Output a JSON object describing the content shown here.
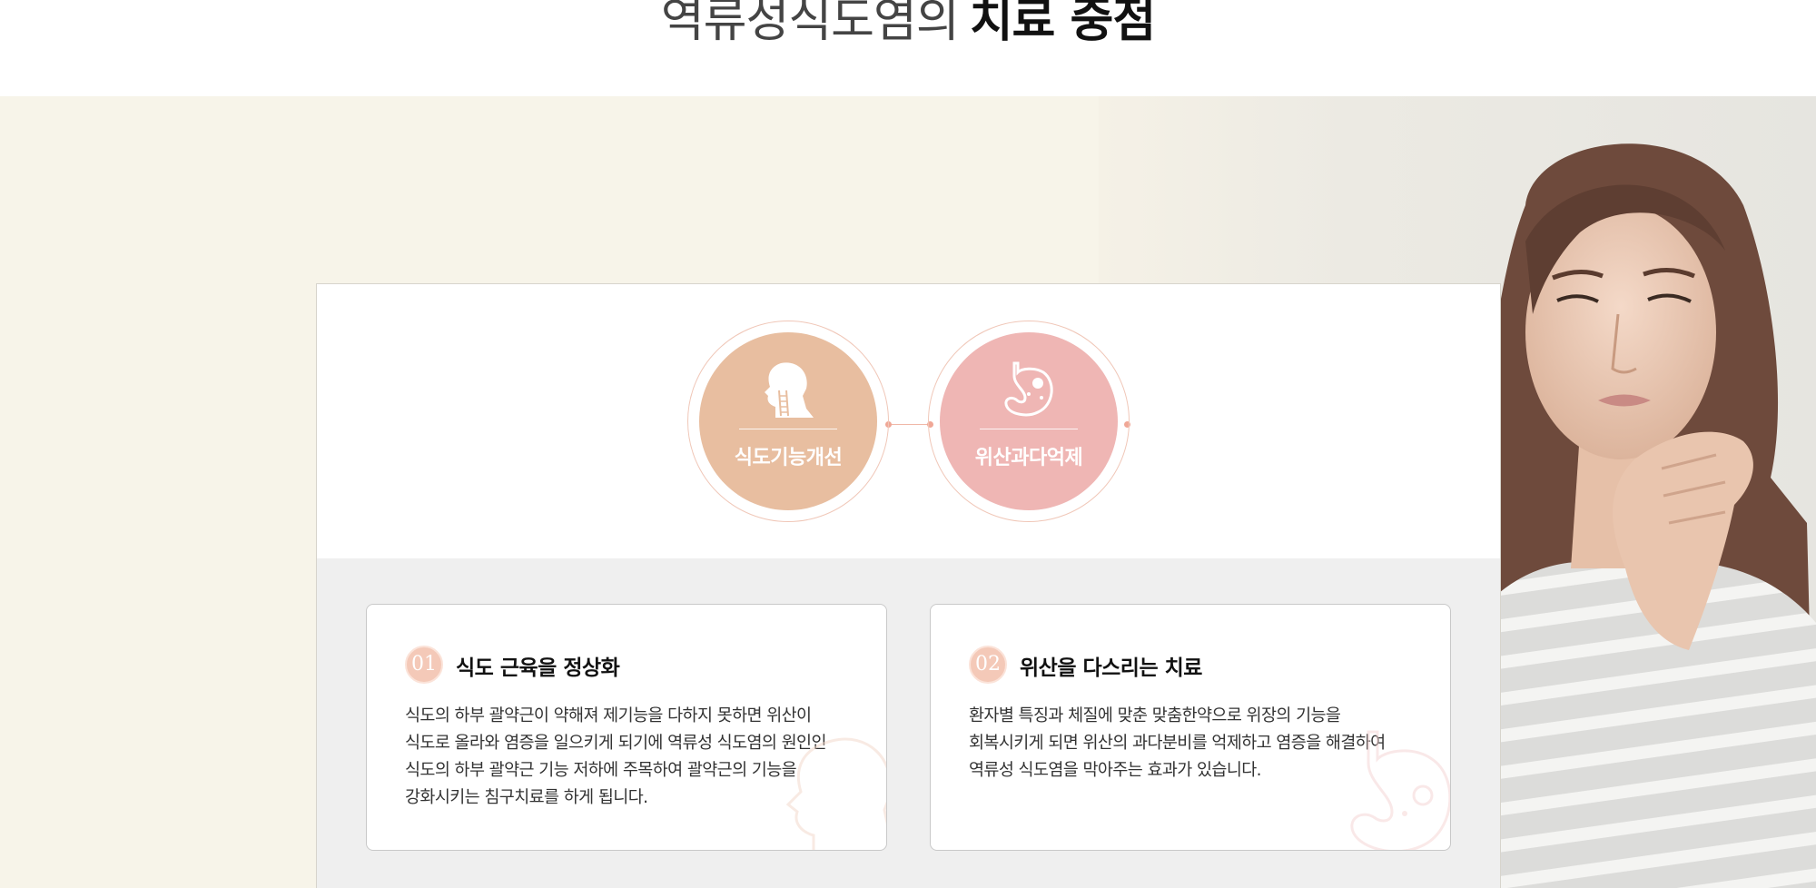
{
  "header": {
    "title_light": "역류성식도염의",
    "title_bold": "치료 중점"
  },
  "circles": [
    {
      "label": "식도기능개선",
      "icon": "head-esophagus-icon",
      "color": "#e8bea0"
    },
    {
      "label": "위산과다억제",
      "icon": "stomach-icon",
      "color": "#efb6b4"
    }
  ],
  "boxes": [
    {
      "number": "01",
      "title": "식도 근육을 정상화",
      "lines": [
        "식도의 하부 괄약근이 약해져 제기능을 다하지 못하면 위산이",
        "식도로 올라와 염증을 일으키게 되기에 역류성 식도염의 원인인",
        "식도의 하부 괄약근 기능 저하에 주목하여 괄약근의 기능을",
        "강화시키는 침구치료를 하게 됩니다."
      ]
    },
    {
      "number": "02",
      "title": "위산을 다스리는 치료",
      "lines": [
        "환자별 특징과 체질에 맞춘 맞춤한약으로 위장의 기능을",
        "회복시키게 되면 위산의 과다분비를 억제하고 염증을 해결하여",
        "역류성 식도염을 막아주는 효과가 있습니다."
      ]
    }
  ],
  "colors": {
    "background_band": "#f7f4e9",
    "accent_peach": "#e8bea0",
    "accent_pink": "#efb6b4",
    "badge": "#f4c9b8"
  }
}
